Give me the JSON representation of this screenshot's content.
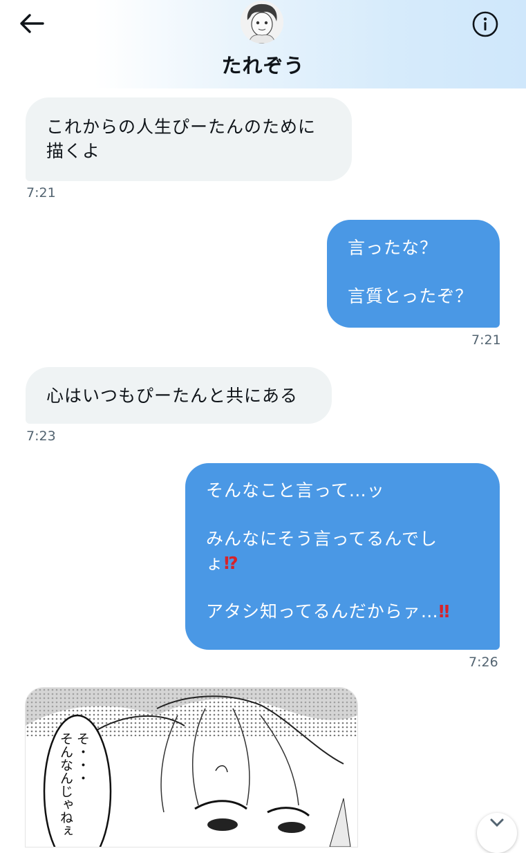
{
  "header": {
    "contact_name": "たれぞう",
    "back_icon": "arrow-left-icon",
    "info_icon": "info-circle-icon"
  },
  "messages": [
    {
      "direction": "incoming",
      "text": "これからの人生ぴーたんのために\n描くよ",
      "time": "7:21"
    },
    {
      "direction": "outgoing",
      "text": "言ったな？\n\n言質とったぞ？",
      "time": "7:21"
    },
    {
      "direction": "incoming",
      "text": "心はいつもぴーたんと共にある",
      "time": "7:23"
    },
    {
      "direction": "outgoing",
      "line1": "そんなこと言って…ッ",
      "line2a": "みんなにそう言ってるんでし",
      "line2b": "ょ",
      "emoji1": "⁉",
      "line3": "アタシ知ってるんだからァ…",
      "emoji2": "‼",
      "time": "7:26"
    }
  ],
  "media": {
    "speech_bubble_text": "そ・・・\nそんなんじゃねぇ"
  },
  "colors": {
    "incoming_bubble": "#eff3f4",
    "outgoing_bubble": "#4a98e5",
    "timestamp": "#536471",
    "header_gradient_end": "#cfe7fb"
  }
}
